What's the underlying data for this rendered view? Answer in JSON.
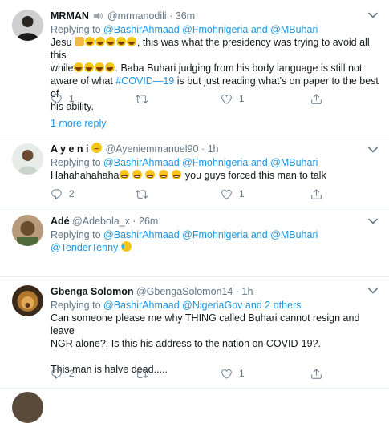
{
  "tweets": [
    {
      "name": "MRMAN",
      "handle": "@mrmanodili",
      "time": "36m",
      "replying_prefix": "Replying to",
      "replying_mentions": "@BashirAhmaad @Fmohnigeria and @MBuhari",
      "body_line1": "Jesu",
      "body_line1_after": ", this was what the presidency was trying to avoid all this",
      "body_line2_pre": "while",
      "body_line2_after": ". Baba Buhari judging from his body language is still not",
      "body_line3_pre": "aware of what ",
      "body_hashtag": "#COVID—19",
      "body_line3_after": " is but just reading what's on paper to the best of",
      "body_line4": "his ability.",
      "reply_count": "1",
      "retweet_count": "",
      "like_count": "1",
      "more_replies": "1 more reply"
    },
    {
      "name": "A y e n i",
      "handle": "@Ayeniemmanuel90",
      "time": "1h",
      "replying_prefix": "Replying to",
      "replying_mentions": "@BashirAhmaad @Fmohnigeria and @MBuhari",
      "body_pre": "Hahahahahaha",
      "body_after": " you guys forced this man to talk",
      "reply_count": "2",
      "retweet_count": "",
      "like_count": "1"
    },
    {
      "name": "Adé",
      "handle": "@Adebola_x",
      "time": "26m",
      "replying_prefix": "Replying to",
      "replying_mentions": "@BashirAhmaad @Fmohnigeria and @MBuhari",
      "body_mention": "@TenderTenny"
    },
    {
      "name": "Gbenga Solomon",
      "handle": "@GbengaSolomon14",
      "time": "1h",
      "replying_prefix": "Replying to",
      "replying_mentions": "@BashirAhmaad @NigeriaGov and 2 others",
      "body_line1": "Can someone please me why THING called Buhari cannot resign and leave",
      "body_line2": "NGR alone?. Is this his address to the nation on COVID-19?.",
      "body_line3": "This man is halve dead.....",
      "reply_count": "2",
      "retweet_count": "",
      "like_count": "1"
    }
  ],
  "colors": {
    "link": "#1b95e0",
    "muted": "#657786",
    "border": "#e6ecf0"
  }
}
